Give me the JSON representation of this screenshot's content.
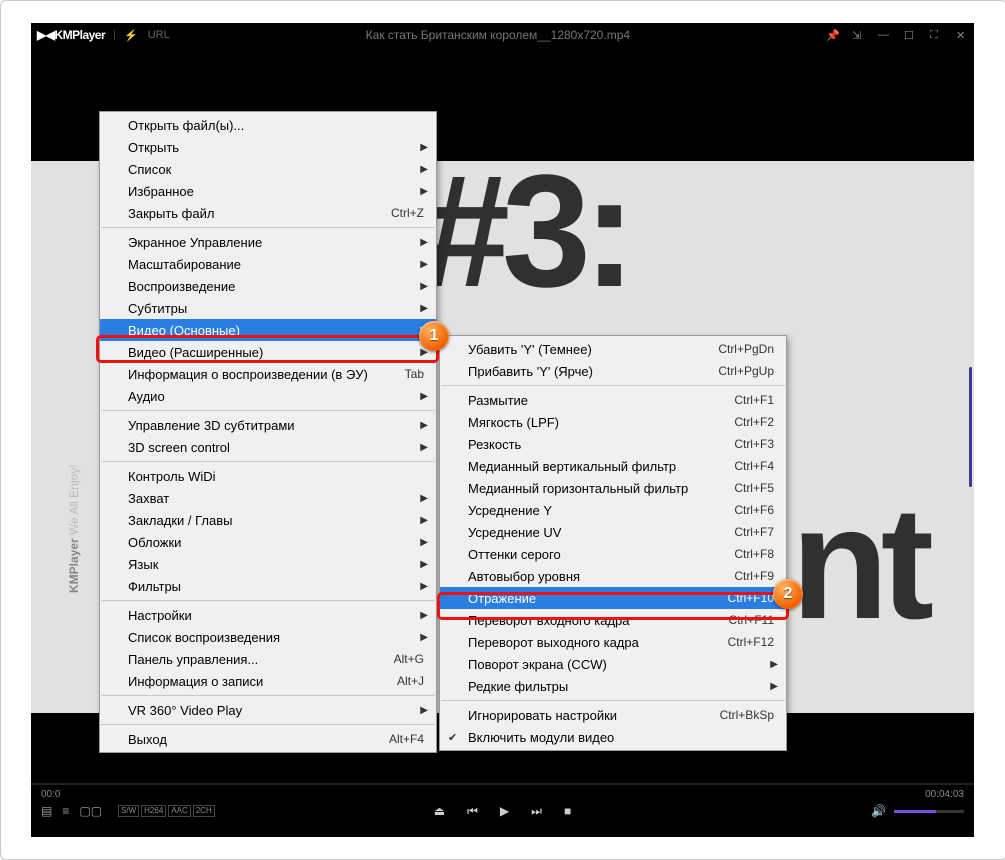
{
  "titlebar": {
    "logo": "▶◀KMPlayer",
    "url": "URL",
    "title": "Как стать Британским королем__1280x720.mp4"
  },
  "video": {
    "text1": "#3:",
    "text2": "nt",
    "side_brand": "KMPlayer",
    "side_tag": "We All Enjoy!"
  },
  "time": {
    "current": "00:0",
    "duration": "00:04:03"
  },
  "badges": [
    "S/W",
    "H264",
    "AAC",
    "2CH"
  ],
  "menu1": [
    {
      "t": "item",
      "label": "Открыть файл(ы)..."
    },
    {
      "t": "item",
      "label": "Открыть",
      "sub": true
    },
    {
      "t": "item",
      "label": "Список",
      "sub": true
    },
    {
      "t": "item",
      "label": "Избранное",
      "sub": true
    },
    {
      "t": "item",
      "label": "Закрыть файл",
      "sc": "Ctrl+Z"
    },
    {
      "t": "sep"
    },
    {
      "t": "item",
      "label": "Экранное Управление",
      "sub": true
    },
    {
      "t": "item",
      "label": "Масштабирование",
      "sub": true
    },
    {
      "t": "item",
      "label": "Воспроизведение",
      "sub": true
    },
    {
      "t": "item",
      "label": "Субтитры",
      "sub": true
    },
    {
      "t": "item",
      "label": "Видео (Основные)",
      "sub": true,
      "selected": true
    },
    {
      "t": "item",
      "label": "Видео (Расширенные)",
      "sub": true
    },
    {
      "t": "item",
      "label": "Информация о воспроизведении (в ЭУ)",
      "sc": "Tab"
    },
    {
      "t": "item",
      "label": "Аудио",
      "sub": true
    },
    {
      "t": "sep"
    },
    {
      "t": "item",
      "label": "Управление 3D субтитрами",
      "sub": true
    },
    {
      "t": "item",
      "label": "3D screen control",
      "sub": true
    },
    {
      "t": "sep"
    },
    {
      "t": "item",
      "label": "Контроль WiDi"
    },
    {
      "t": "item",
      "label": "Захват",
      "sub": true
    },
    {
      "t": "item",
      "label": "Закладки / Главы",
      "sub": true
    },
    {
      "t": "item",
      "label": "Обложки",
      "sub": true
    },
    {
      "t": "item",
      "label": "Язык",
      "sub": true
    },
    {
      "t": "item",
      "label": "Фильтры",
      "sub": true
    },
    {
      "t": "sep"
    },
    {
      "t": "item",
      "label": "Настройки",
      "sub": true
    },
    {
      "t": "item",
      "label": "Список воспроизведения",
      "sub": true
    },
    {
      "t": "item",
      "label": "Панель управления...",
      "sc": "Alt+G"
    },
    {
      "t": "item",
      "label": "Информация о записи",
      "sc": "Alt+J"
    },
    {
      "t": "sep"
    },
    {
      "t": "item",
      "label": "VR 360° Video Play",
      "sub": true
    },
    {
      "t": "sep"
    },
    {
      "t": "item",
      "label": "Выход",
      "sc": "Alt+F4"
    }
  ],
  "menu2": [
    {
      "t": "item",
      "label": "Убавить 'Y' (Темнее)",
      "sc": "Ctrl+PgDn"
    },
    {
      "t": "item",
      "label": "Прибавить 'Y' (Ярче)",
      "sc": "Ctrl+PgUp"
    },
    {
      "t": "sep"
    },
    {
      "t": "item",
      "label": "Размытие",
      "sc": "Ctrl+F1"
    },
    {
      "t": "item",
      "label": "Мягкость (LPF)",
      "sc": "Ctrl+F2"
    },
    {
      "t": "item",
      "label": "Резкость",
      "sc": "Ctrl+F3"
    },
    {
      "t": "item",
      "label": "Медианный вертикальный фильтр",
      "sc": "Ctrl+F4"
    },
    {
      "t": "item",
      "label": "Медианный горизонтальный фильтр",
      "sc": "Ctrl+F5"
    },
    {
      "t": "item",
      "label": "Усреднение  Y",
      "sc": "Ctrl+F6"
    },
    {
      "t": "item",
      "label": "Усреднение  UV",
      "sc": "Ctrl+F7"
    },
    {
      "t": "item",
      "label": "Оттенки серого",
      "sc": "Ctrl+F8"
    },
    {
      "t": "item",
      "label": "Автовыбор уровня",
      "sc": "Ctrl+F9"
    },
    {
      "t": "item",
      "label": "Отражение",
      "sc": "Ctrl+F10",
      "selected": true
    },
    {
      "t": "item",
      "label": "Переворот входного кадра",
      "sc": "Ctrl+F11"
    },
    {
      "t": "item",
      "label": "Переворот выходного кадра",
      "sc": "Ctrl+F12"
    },
    {
      "t": "item",
      "label": "Поворот экрана (CCW)",
      "sub": true
    },
    {
      "t": "item",
      "label": "Редкие фильтры",
      "sub": true
    },
    {
      "t": "sep"
    },
    {
      "t": "item",
      "label": "Игнорировать настройки",
      "sc": "Ctrl+BkSp"
    },
    {
      "t": "item",
      "label": "Включить модули видео",
      "check": true
    }
  ],
  "annotations": {
    "n1": "1",
    "n2": "2"
  }
}
